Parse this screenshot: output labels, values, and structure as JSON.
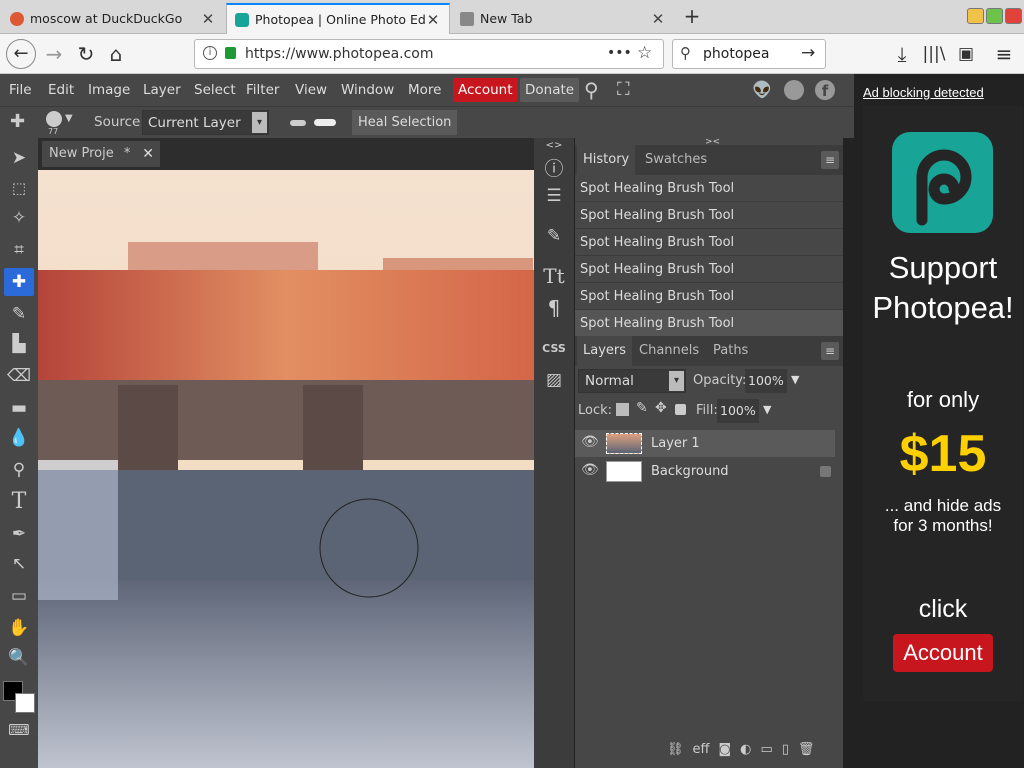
{
  "browser": {
    "tabs": [
      {
        "title": "moscow at DuckDuckGo",
        "favicon_color": "#de5833"
      },
      {
        "title": "Photopea | Online Photo Edit",
        "favicon_color": "#18a497"
      },
      {
        "title": "New Tab",
        "favicon_color": "#888888"
      }
    ],
    "url": "https://www.photopea.com",
    "search_value": "photopea",
    "url_dots": "•••"
  },
  "menu": {
    "items": [
      "File",
      "Edit",
      "Image",
      "Layer",
      "Select",
      "Filter",
      "View",
      "Window",
      "More"
    ],
    "account": "Account",
    "donate": "Donate",
    "account_color": "#c8161e"
  },
  "options": {
    "brush_size": "77",
    "source_label": "Source:",
    "source_value": "Current Layer",
    "heal_button": "Heal Selection"
  },
  "document": {
    "tab_title": "New Proje",
    "modified_marker": "*",
    "close": "✕"
  },
  "history": {
    "tabs": [
      "History",
      "Swatches"
    ],
    "items": [
      "Spot Healing Brush Tool",
      "Spot Healing Brush Tool",
      "Spot Healing Brush Tool",
      "Spot Healing Brush Tool",
      "Spot Healing Brush Tool",
      "Spot Healing Brush Tool"
    ]
  },
  "layers": {
    "tabs": [
      "Layers",
      "Channels",
      "Paths"
    ],
    "blend_mode": "Normal",
    "opacity_label": "Opacity:",
    "opacity_value": "100%",
    "lock_label": "Lock:",
    "fill_label": "Fill:",
    "fill_value": "100%",
    "items": [
      {
        "name": "Layer 1",
        "locked": false
      },
      {
        "name": "Background",
        "locked": true
      }
    ]
  },
  "strip": {
    "css_label": "CSS"
  },
  "ad": {
    "link": "Ad blocking detected",
    "line1": "Support",
    "line2": "Photopea!",
    "line3": "for only",
    "price": "$15",
    "line4": "... and hide ads",
    "line5": "for 3 months!",
    "click": "click",
    "button": "Account",
    "brand_color": "#18a497",
    "price_color": "#ffd000"
  }
}
